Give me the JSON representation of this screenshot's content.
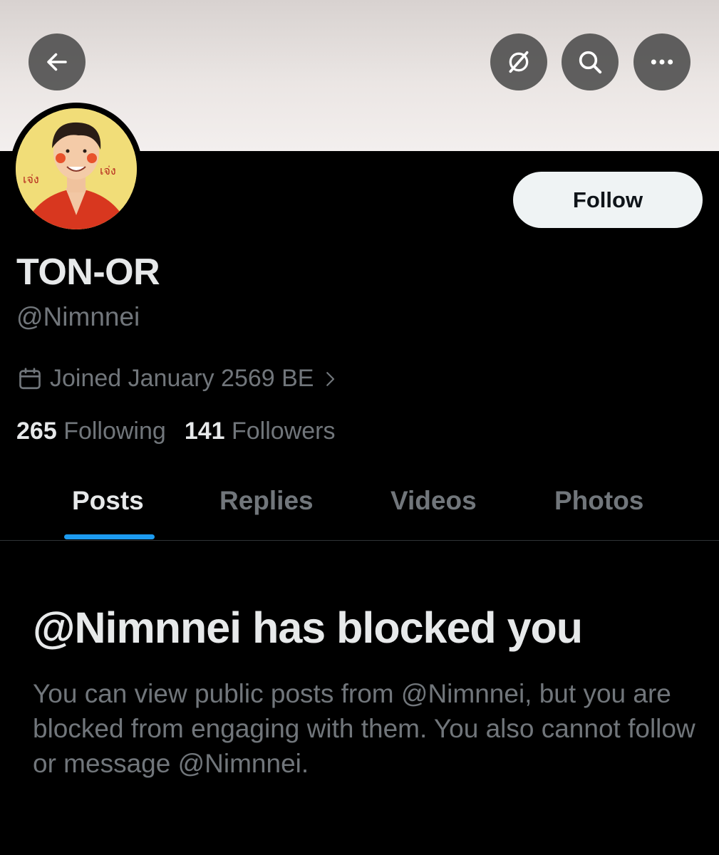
{
  "header": {
    "back_icon": "arrow-left-icon",
    "grok_icon": "grok-slash-circle-icon",
    "search_icon": "search-icon",
    "more_icon": "more-dots-icon"
  },
  "profile": {
    "display_name": "TON-OR",
    "handle": "@Nimnnei",
    "avatar_text_left": "เจ่ง",
    "avatar_text_right": "เจ่ง",
    "joined": "Joined January 2569 BE",
    "following_count": "265",
    "following_label": "Following",
    "followers_count": "141",
    "followers_label": "Followers",
    "follow_button": "Follow"
  },
  "tabs": [
    {
      "label": "Posts",
      "active": true
    },
    {
      "label": "Replies",
      "active": false
    },
    {
      "label": "Videos",
      "active": false
    },
    {
      "label": "Photos",
      "active": false
    }
  ],
  "blocked": {
    "title": "@Nimnnei has blocked you",
    "body": "You can view public posts from @Nimnnei, but you are blocked from engaging with them. You also cannot follow or message @Nimnnei."
  },
  "colors": {
    "background": "#000000",
    "accent": "#1d9bf0",
    "primary_text": "#e7e9ea",
    "secondary_text": "#71767b",
    "follow_button_bg": "#eff3f4"
  }
}
